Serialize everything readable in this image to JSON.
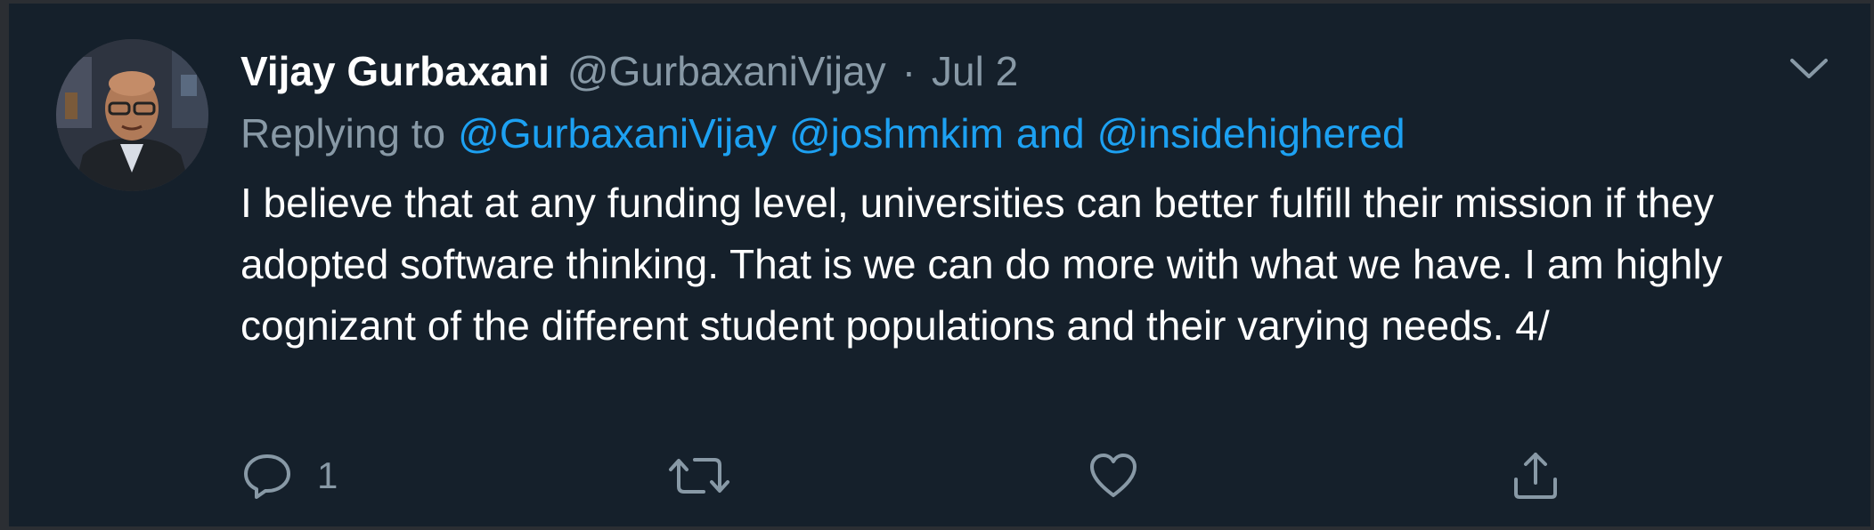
{
  "author": {
    "display_name": "Vijay Gurbaxani",
    "handle": "@GurbaxaniVijay",
    "separator": "·",
    "date": "Jul 2"
  },
  "reply": {
    "prefix": "Replying to",
    "mention_1": "@GurbaxaniVijay",
    "mention_2": "@joshmkim",
    "conjunction": "and",
    "mention_3": "@insidehighered"
  },
  "tweet": {
    "text": "I believe that at any funding level, universities can better fulfill their mission if they adopted software thinking. That is we can do more with what we have. I am highly cognizant of the different student populations and their varying needs. 4/"
  },
  "actions": {
    "reply_count": "1",
    "retweet_count": "",
    "like_count": ""
  },
  "icons": {
    "reply": "speech-bubble-icon",
    "retweet": "retweet-arrows-icon",
    "like": "heart-icon",
    "share": "share-upload-icon",
    "more": "chevron-down-icon"
  },
  "colors": {
    "background": "#15202b",
    "text": "#ffffff",
    "secondary": "#8899a6",
    "accent": "#1da1f2"
  }
}
